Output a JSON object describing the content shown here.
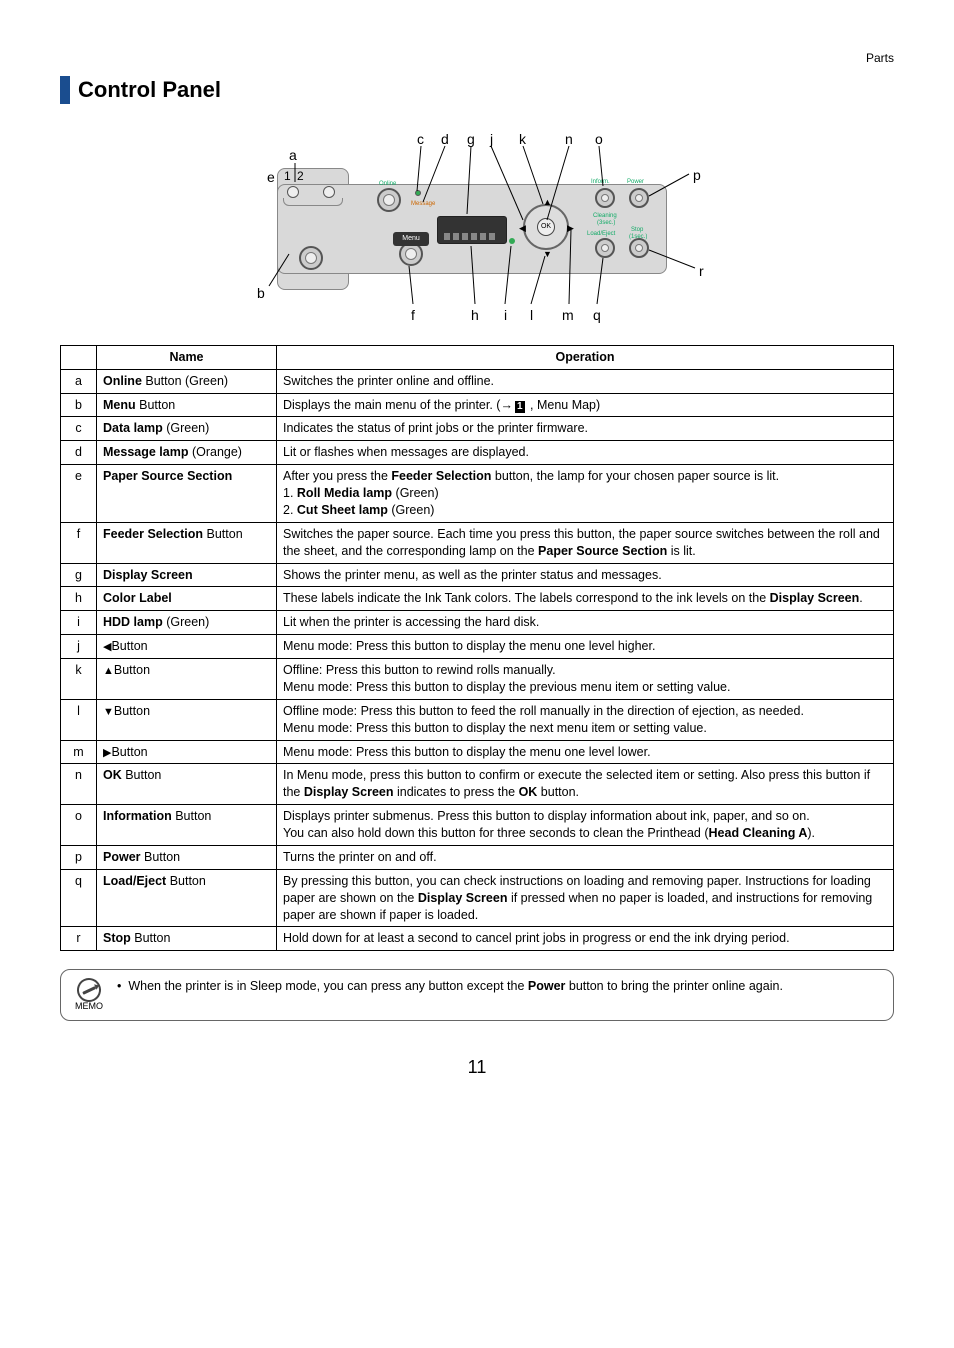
{
  "header": {
    "section": "Parts"
  },
  "title": "Control Panel",
  "diagram_labels": {
    "a": "a",
    "b": "b",
    "c": "c",
    "d": "d",
    "e": "e",
    "f": "f",
    "g": "g",
    "h": "h",
    "i": "i",
    "j": "j",
    "k": "k",
    "l": "l",
    "m": "m",
    "n": "n",
    "o": "o",
    "p": "p",
    "q": "q",
    "r": "r",
    "one": "1",
    "two": "2"
  },
  "diagram_ui": {
    "menu_label": "Menu",
    "ok_label": "OK",
    "online_label": "Online",
    "message_label": "Message",
    "inform_label": "Inform.",
    "power_label": "Power",
    "cleaning_label": "Cleaning",
    "cleaning_sub": "(3sec.)",
    "load_label": "Load/Eject",
    "stop_label": "Stop",
    "stop_sub": "(1sec.)"
  },
  "table": {
    "head_name": "Name",
    "head_operation": "Operation",
    "rows": [
      {
        "id": "a",
        "name_bold": "Online",
        "name_rest": " Button (Green)",
        "op": "Switches the printer online and offline."
      },
      {
        "id": "b",
        "name_bold": "Menu",
        "name_rest": " Button",
        "op_pre": "Displays the main menu of the printer. (→",
        "op_box": "1",
        "op_post": " , Menu Map)"
      },
      {
        "id": "c",
        "name_bold": "Data lamp",
        "name_rest": " (Green)",
        "op": "Indicates the status of print jobs or the printer firmware."
      },
      {
        "id": "d",
        "name_bold": "Message lamp",
        "name_rest": " (Orange)",
        "op": "Lit or flashes when messages are displayed."
      },
      {
        "id": "e",
        "name_bold": "Paper Source Section",
        "name_rest": "",
        "op_line1_pre": "After you press the ",
        "op_line1_b": "Feeder Selection",
        "op_line1_post": " button, the lamp for your chosen paper source is lit.",
        "op_line2_pre": "1. ",
        "op_line2_b": "Roll Media lamp",
        "op_line2_post": " (Green)",
        "op_line3_pre": "2. ",
        "op_line3_b": "Cut Sheet lamp",
        "op_line3_post": " (Green)"
      },
      {
        "id": "f",
        "name_bold": "Feeder Selection",
        "name_rest": " Button",
        "op_pre": "Switches the paper source. Each time you press this button, the paper source switches between the roll and the sheet, and the corresponding lamp on the ",
        "op_b1": "Paper Source Section",
        "op_post": " is lit."
      },
      {
        "id": "g",
        "name_bold": "Display Screen",
        "name_rest": "",
        "op": "Shows the printer menu, as well as the printer status and messages."
      },
      {
        "id": "h",
        "name_bold": "Color Label",
        "name_rest": "",
        "op_pre": "These labels indicate the Ink Tank colors. The labels correspond to the ink levels on the ",
        "op_b1": "Display Screen",
        "op_post": "."
      },
      {
        "id": "i",
        "name_bold": "HDD lamp",
        "name_rest": " (Green)",
        "op": "Lit when the printer is accessing the hard disk."
      },
      {
        "id": "j",
        "name_bold": "",
        "name_prefix": "◀ ",
        "name_rest": "Button",
        "op": "Menu mode: Press this button to display the menu one level higher."
      },
      {
        "id": "k",
        "name_bold": "",
        "name_prefix": "▲ ",
        "name_rest": "Button",
        "op_l1": "Offline: Press this button to rewind rolls manually.",
        "op_l2": "Menu mode: Press this button to display the previous menu item or setting value."
      },
      {
        "id": "l",
        "name_bold": "",
        "name_prefix": "▼ ",
        "name_rest": "Button",
        "op_l1": "Offline mode: Press this button to feed the roll manually in the direction of ejection, as needed.",
        "op_l2": "Menu mode: Press this button to display the next menu item or setting value."
      },
      {
        "id": "m",
        "name_bold": "",
        "name_prefix": "▶ ",
        "name_rest": "Button",
        "op": "Menu mode: Press this button to display the menu one level lower."
      },
      {
        "id": "n",
        "name_bold": "OK",
        "name_rest": " Button",
        "op_pre": "In Menu mode, press this button to confirm or execute the selected item or setting. Also press this button if the ",
        "op_b1": "Display Screen",
        "op_mid": " indicates to press the ",
        "op_b2": "OK",
        "op_post": " button."
      },
      {
        "id": "o",
        "name_bold": "Information",
        "name_rest": " Button",
        "op_l1": "Displays printer submenus. Press this button to display information about ink, paper, and so on.",
        "op_l2_pre": "You can also hold down this button for three seconds to clean the Printhead (",
        "op_l2_b": "Head Cleaning A",
        "op_l2_post": ")."
      },
      {
        "id": "p",
        "name_bold": "Power",
        "name_rest": " Button",
        "op": "Turns the printer on and off."
      },
      {
        "id": "q",
        "name_bold": "Load/Eject",
        "name_rest": " Button",
        "op_pre": "By pressing this button, you can check instructions on loading and removing paper. Instructions for loading paper are shown on the ",
        "op_b1": "Display Screen",
        "op_post": " if pressed when no paper is loaded, and instructions for removing paper are shown if paper is loaded."
      },
      {
        "id": "r",
        "name_bold": "Stop",
        "name_rest": " Button",
        "op": "Hold down for at least a second to cancel print jobs in progress or end the ink drying period."
      }
    ]
  },
  "memo": {
    "label": "MEMO",
    "bullet": "•",
    "text_pre": "When the printer is in Sleep mode, you can press any button except the ",
    "text_b": "Power",
    "text_post": " button to bring the printer online again."
  },
  "page_number": "11"
}
